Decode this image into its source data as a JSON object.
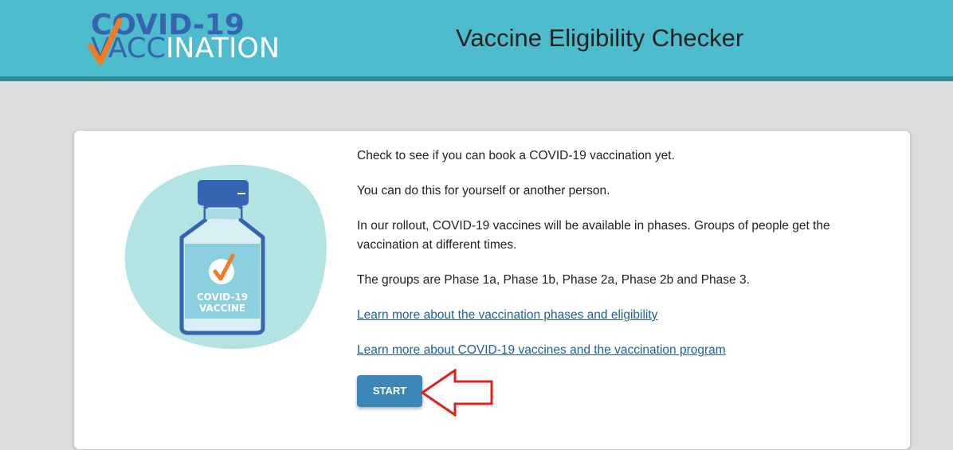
{
  "header": {
    "logo_line1": "COVID-19",
    "logo_line2_v": "V",
    "logo_line2_acc": "ACC",
    "logo_line2_rest": "INATION",
    "title": "Vaccine Eligibility Checker"
  },
  "illustration": {
    "label_line1": "COVID-19",
    "label_line2": "VACCINE"
  },
  "content": {
    "p1": "Check to see if you can book a COVID-19 vaccination yet.",
    "p2": "You can do this for yourself or another person.",
    "p3": "In our rollout, COVID-19 vaccines will be available in phases. Groups of people get the vaccination at different times.",
    "p4": "The groups are Phase 1a, Phase 1b, Phase 2a, Phase 2b and Phase 3.",
    "link1": "Learn more about the vaccination phases and eligibility",
    "link2": "Learn more about COVID-19 vaccines and the vaccination program"
  },
  "actions": {
    "start_label": "START"
  },
  "colors": {
    "header_bg": "#4dbccc",
    "header_stripe": "#2e8a95",
    "brand_blue": "#3564b0",
    "check_orange": "#f07b22",
    "button_bg": "#3c87b9",
    "link": "#1a5f9e",
    "annotation_arrow": "#e0201c"
  }
}
